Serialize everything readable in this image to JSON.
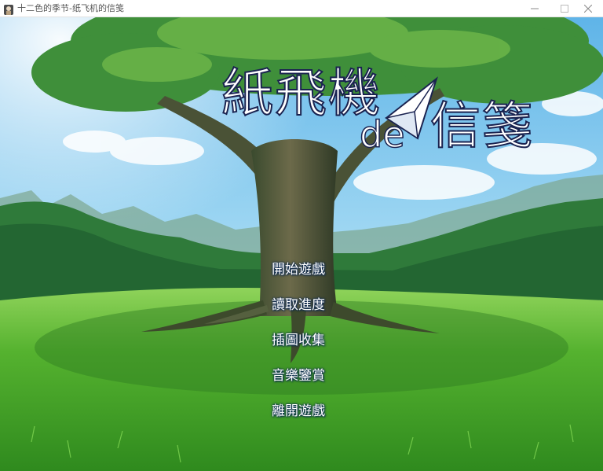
{
  "window": {
    "title": "十二色的季节-纸飞机的信笺",
    "icon": "game-app-icon",
    "controls": [
      "minimize-icon",
      "maximize-icon",
      "close-icon"
    ]
  },
  "logo": {
    "main": "紙飛機",
    "de": "de",
    "sub": "信箋"
  },
  "menu": {
    "items": [
      "開始遊戲",
      "讀取進度",
      "插圖收集",
      "音樂鑒賞",
      "離開遊戲"
    ]
  },
  "colors": {
    "sky": "#7ec4ec",
    "grass": "#3fa02a",
    "menu_text": "#ffffff",
    "logo_outline": "#1a2350"
  }
}
